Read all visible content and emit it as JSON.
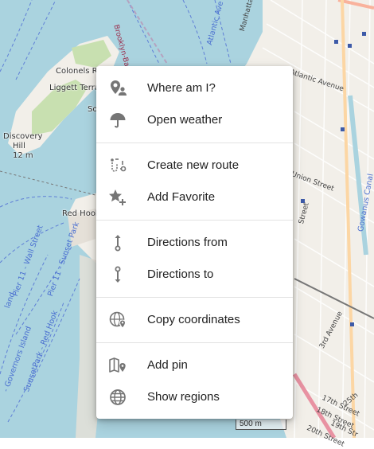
{
  "map": {
    "labels": {
      "colonels_row": "Colonels Row",
      "liggett_terrace": "Liggett Terra",
      "so": "So",
      "discovery_hill": "Discovery",
      "discovery_hill_2": "Hill",
      "elevation": "12 m",
      "red_hook": "Red Hook",
      "brooklyn_battery_tunnel": "Brooklyn-Battery T",
      "manhattan": "Manhattan",
      "atlantic_ave_water": "Atlantic Ave",
      "atlantic_avenue": "Atlantic Avenue",
      "union_street": "Union Street",
      "gowanus_canal": "Gowanus Canal",
      "street_left": "Street",
      "third_avenue": "3rd Avenue",
      "twentyfifth": "25th",
      "seventeenth": "17th Street",
      "eighteenth": "18th Street",
      "nineteenth": "19th Str",
      "twentieth": "20th Street",
      "pier_wall_street": "Pier 11 - Wall Street",
      "pier_sunset_park": "Pier 11 - Sunset Park",
      "sunset_red_hook": "SunsetPark - Red Hook",
      "governors_island": "- Governors Island",
      "land_island": "land"
    },
    "scale_label": "500 m"
  },
  "context_menu": {
    "items": [
      {
        "name": "where-am-i",
        "label": "Where am I?",
        "icon": "location-person-icon"
      },
      {
        "name": "open-weather",
        "label": "Open weather",
        "icon": "umbrella-icon"
      },
      {
        "name": "create-new-route",
        "label": "Create new route",
        "icon": "route-icon"
      },
      {
        "name": "add-favorite",
        "label": "Add Favorite",
        "icon": "star-plus-icon"
      },
      {
        "name": "directions-from",
        "label": "Directions from",
        "icon": "direction-from-icon"
      },
      {
        "name": "directions-to",
        "label": "Directions to",
        "icon": "direction-to-icon"
      },
      {
        "name": "copy-coordinates",
        "label": "Copy coordinates",
        "icon": "globe-pin-icon"
      },
      {
        "name": "add-pin",
        "label": "Add pin",
        "icon": "map-pin-icon"
      },
      {
        "name": "show-regions",
        "label": "Show regions",
        "icon": "globe-icon"
      }
    ]
  },
  "colors": {
    "water": "#aad3df",
    "land": "#f2efe9",
    "park": "#c8e0b0",
    "icon": "#757575",
    "text": "#212121"
  }
}
